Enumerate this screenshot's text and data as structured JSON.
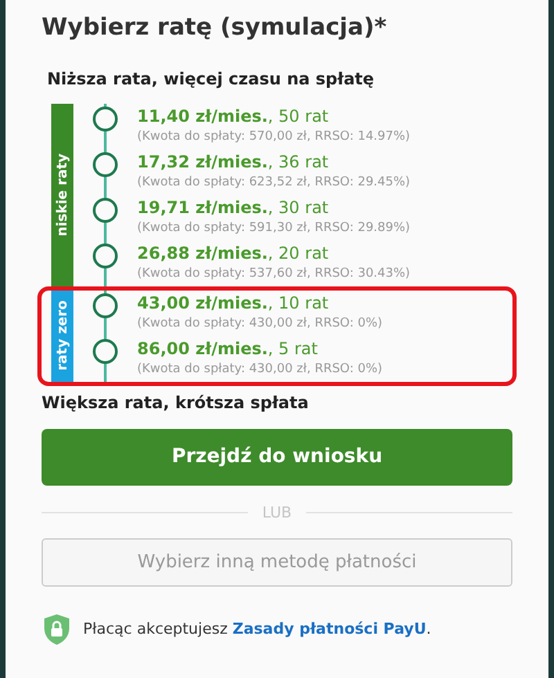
{
  "title": "Wybierz ratę (symulacja)*",
  "top_hint": "Niższa rata, więcej czasu na spłatę",
  "groups": [
    {
      "label": "niskie raty",
      "color": "#3b8a2a",
      "highlighted": false,
      "options": [
        {
          "rate": "**11,40 zł/mies.**, 50 rat",
          "details": "(Kwota do spłaty: 570,00 zł, RRSO: 14.97%)"
        },
        {
          "rate": "**17,32 zł/mies.**, 36 rat",
          "details": "(Kwota do spłaty: 623,52 zł, RRSO: 29.45%)"
        },
        {
          "rate": "**19,71 zł/mies.**, 30 rat",
          "details": "(Kwota do spłaty: 591,30 zł, RRSO: 29.89%)"
        },
        {
          "rate": "**26,88 zł/mies.**, 20 rat",
          "details": "(Kwota do spłaty: 537,60 zł, RRSO: 30.43%)"
        }
      ]
    },
    {
      "label": "raty zero",
      "color": "#1ba3e0",
      "highlighted": true,
      "options": [
        {
          "rate": "**43,00 zł/mies.**, 10 rat",
          "details": "(Kwota do spłaty: 430,00 zł, RRSO: 0%)"
        },
        {
          "rate": "**86,00 zł/mies.**, 5 rat",
          "details": "(Kwota do spłaty: 430,00 zł, RRSO: 0%)"
        }
      ]
    }
  ],
  "bottom_hint": "Większa rata, krótsza spłata",
  "primary_button": "Przejdź do wniosku",
  "separator": "LUB",
  "secondary_button": "Wybierz inną metodę płatności",
  "footer": {
    "text": "Płacąc akceptujesz",
    "link": "Zasady płatności PayU",
    "end": "."
  }
}
